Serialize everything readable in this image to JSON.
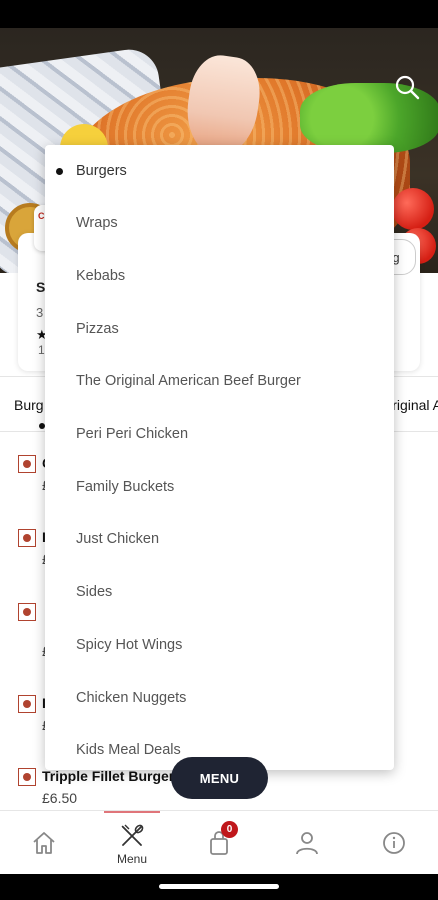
{
  "hero": {
    "image_label": "Crispy fried chicken fillet with lemon and salad"
  },
  "info_card": {
    "title_fragment": "S",
    "line_fragment": "3",
    "star": "★",
    "count_fragment": "1",
    "chip_fragment": "g"
  },
  "tabs": {
    "left_label": "Burg",
    "right_label": "riginal A"
  },
  "menu_items": [
    {
      "name": "C",
      "price": "£"
    },
    {
      "name": "I",
      "price": "£"
    },
    {
      "name": "",
      "price": "£"
    },
    {
      "name": "I",
      "price": "£"
    },
    {
      "name": "Tripple Fillet Burger",
      "price": "£6.50"
    }
  ],
  "dropdown": {
    "selected": "Burgers",
    "items": [
      "Burgers",
      "Wraps",
      "Kebabs",
      "Pizzas",
      "The Original American Beef Burger",
      "Peri Peri Chicken",
      "Family Buckets",
      "Just Chicken",
      "Sides",
      "Spicy Hot Wings",
      "Chicken Nuggets",
      "Kids Meal Deals"
    ]
  },
  "menu_button": {
    "label": "MENU"
  },
  "bottom_nav": {
    "active_color": "#e0757a",
    "items": [
      {
        "icon": "home-icon",
        "label": ""
      },
      {
        "icon": "utensils-icon",
        "label": "Menu"
      },
      {
        "icon": "shopping-bag-icon",
        "label": "",
        "badge": "0"
      },
      {
        "icon": "user-icon",
        "label": ""
      },
      {
        "icon": "info-icon",
        "label": ""
      }
    ]
  },
  "colors": {
    "menu_pill": "#1f2433",
    "badge": "#c0171b",
    "veg_marker": "#b0432f"
  }
}
